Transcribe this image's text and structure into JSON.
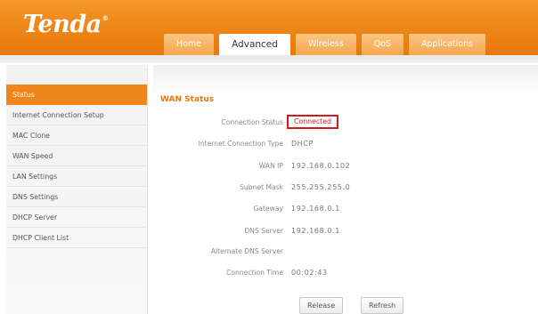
{
  "brand": {
    "name": "Tenda",
    "mark": "®"
  },
  "tabs": [
    {
      "label": "Home"
    },
    {
      "label": "Advanced"
    },
    {
      "label": "Wireless"
    },
    {
      "label": "QoS"
    },
    {
      "label": "Applications"
    }
  ],
  "active_tab": "Advanced",
  "sidebar": {
    "items": [
      {
        "label": "Status"
      },
      {
        "label": "Internet Connection Setup"
      },
      {
        "label": "MAC Clone"
      },
      {
        "label": "WAN Speed"
      },
      {
        "label": "LAN Settings"
      },
      {
        "label": "DNS Settings"
      },
      {
        "label": "DHCP Server"
      },
      {
        "label": "DHCP Client List"
      }
    ],
    "active_item": "Status"
  },
  "main": {
    "section_title": "WAN Status",
    "fields": {
      "connection_status": {
        "label": "Connection Status",
        "value": "Connected"
      },
      "connection_type": {
        "label": "Internet Connection Type",
        "value": "DHCP"
      },
      "wan_ip": {
        "label": "WAN IP",
        "value": "192.168.0.102"
      },
      "subnet_mask": {
        "label": "Subnet Mask",
        "value": "255.255.255.0"
      },
      "gateway": {
        "label": "Gateway",
        "value": "192.168.0.1"
      },
      "dns_server": {
        "label": "DNS Server",
        "value": "192.168.0.1"
      },
      "alt_dns_server": {
        "label": "Alternate DNS Server",
        "value": ""
      },
      "connection_time": {
        "label": "Connection Time",
        "value": "00:02:43"
      }
    },
    "buttons": {
      "release": "Release",
      "refresh": "Refresh"
    }
  },
  "colors": {
    "brand_orange": "#ef8719",
    "status_highlight": "#d1191f",
    "section_title": "#e8780c"
  }
}
